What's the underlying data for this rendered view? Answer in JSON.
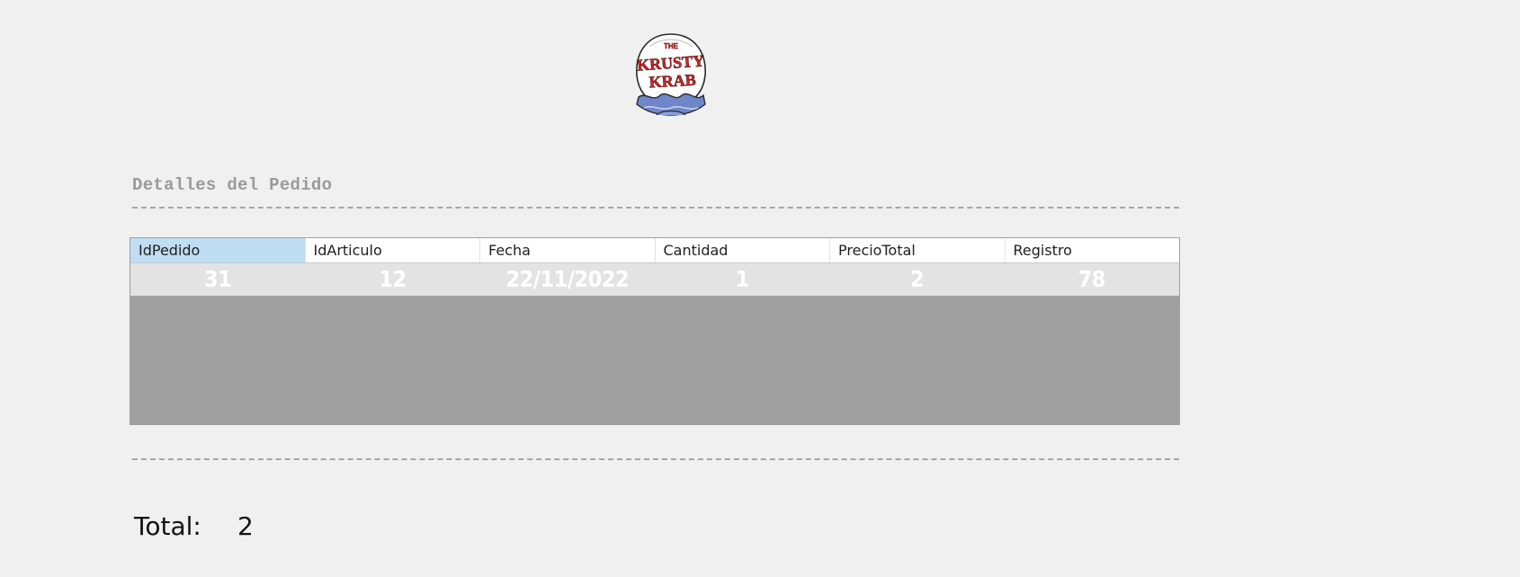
{
  "logo": {
    "icon": "krusty-krab-logo",
    "text_line1": "THE",
    "text_line2": "KRUSTY",
    "text_line3": "KRAB",
    "colors": {
      "red": "#c62828",
      "shell": "#ffffff",
      "water": "#6f86c9"
    }
  },
  "title": "Detalles del Pedido",
  "dashes": "------------------------------------------------------------------------------------------------------",
  "grid": {
    "columns": [
      "IdPedido",
      "IdArticulo",
      "Fecha",
      "Cantidad",
      "PrecioTotal",
      "Registro"
    ],
    "selected_column": "IdPedido",
    "rows": [
      [
        "31",
        "12",
        "22/11/2022",
        "1",
        "2",
        "78"
      ]
    ]
  },
  "total": {
    "label": "Total:",
    "value": "2"
  },
  "colors": {
    "background": "#f0f0f0",
    "grid_empty": "#a0a0a0",
    "row_background": "#e3e3e3",
    "header_selected": "#bfddf3",
    "title_gray": "#9a9a9a"
  }
}
